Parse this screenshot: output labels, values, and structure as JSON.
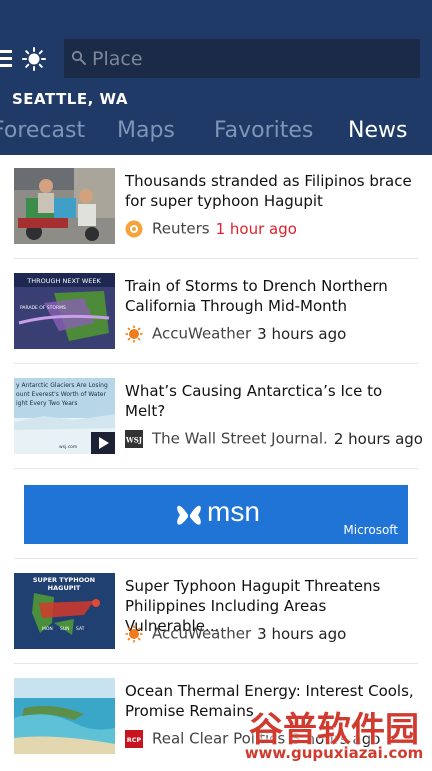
{
  "header": {
    "search_placeholder": "Place",
    "location": "SEATTLE, WA",
    "tabs": [
      {
        "label": "Forecast",
        "active": false
      },
      {
        "label": "Maps",
        "active": false
      },
      {
        "label": "Favorites",
        "active": false
      },
      {
        "label": "News",
        "active": true
      }
    ]
  },
  "news": [
    {
      "headline": "Thousands stranded as Filipinos brace for super typhoon Hagupit",
      "source": "Reuters",
      "time": "1 hour ago",
      "recent": true,
      "icon": "reuters-icon"
    },
    {
      "headline": "Train of Storms to Drench Northern California Through Mid-Month",
      "source": "AccuWeather",
      "time": "3 hours ago",
      "recent": false,
      "icon": "accuweather-icon",
      "thumb_text": [
        "THROUGH NEXT WEEK",
        "PARADE OF STORMS"
      ]
    },
    {
      "headline": "What’s Causing Antarctica’s Ice to Melt?",
      "source": "The Wall Street Journal.",
      "time": "2 hours ago",
      "recent": false,
      "icon": "wsj-icon",
      "thumb_text": [
        "y Antarctic Glaciers Are Losing",
        "ount Everest's Worth of Water",
        "ight Every Two Years",
        "wsj.com"
      ]
    },
    {
      "headline": "Super Typhoon Hagupit Threatens Philippines Including Areas Vulnerable...",
      "source": "AccuWeather",
      "time": "3 hours ago",
      "recent": false,
      "icon": "accuweather-icon",
      "thumb_text": [
        "SUPER TYPHOON",
        "HAGUPIT",
        "MON",
        "SUN",
        "SAT"
      ]
    },
    {
      "headline": "Ocean Thermal Energy: Interest Cools, Promise Remains",
      "source": "Real Clear Politics",
      "time": "3 hours ago",
      "recent": false,
      "icon": "rcp-icon"
    }
  ],
  "ad": {
    "text": "msn",
    "brand": "Microsoft"
  },
  "watermark": {
    "title": "谷普软件园",
    "url": "www.gupuxiazai.com"
  },
  "colors": {
    "header_bg": "#1f3a66",
    "search_bg": "#1b2a46",
    "tab_inactive": "#7f95b6",
    "recent_time": "#e0212a",
    "ad_bg": "#1f74d6"
  }
}
